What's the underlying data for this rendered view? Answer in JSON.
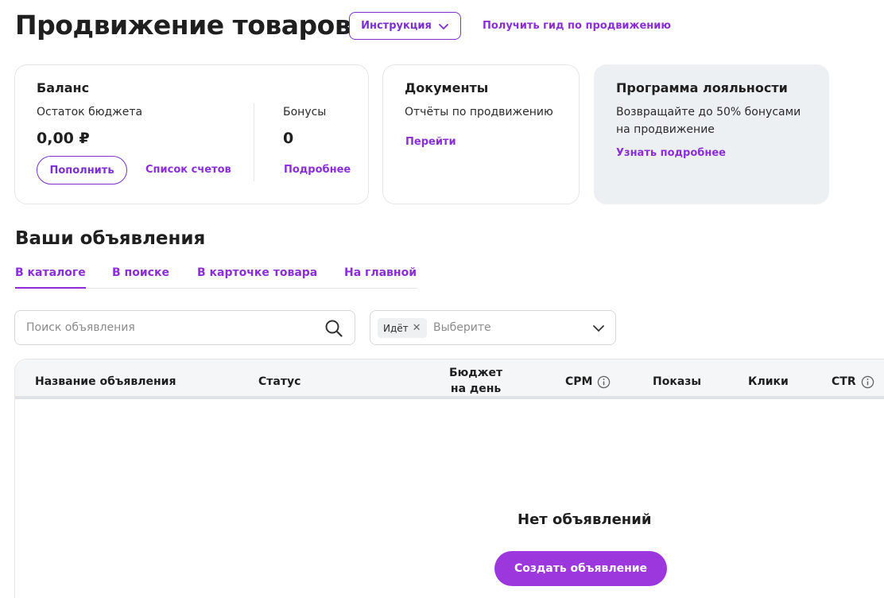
{
  "header": {
    "title": "Продвижение товаров",
    "instruction_label": "Инструкция",
    "guide_link": "Получить гид по продвижению"
  },
  "balance": {
    "title": "Баланс",
    "budget_label": "Остаток бюджета",
    "budget_value": "0,00 ₽",
    "topup_label": "Пополнить",
    "invoices_link": "Список счетов",
    "bonuses_label": "Бонусы",
    "bonuses_value": "0",
    "details_link": "Подробнее"
  },
  "documents": {
    "title": "Документы",
    "text": "Отчёты по продвижению",
    "link": "Перейти"
  },
  "loyalty": {
    "title": "Программа лояльности",
    "text_line1": "Возвращайте до 50% бонусами",
    "text_line2": "на продвижение",
    "link": "Узнать подробнее",
    "bg_color": "#edf0f2"
  },
  "ads": {
    "title": "Ваши объявления",
    "tabs": [
      {
        "label": "В каталоге",
        "active": true
      },
      {
        "label": "В поиске",
        "active": false
      },
      {
        "label": "В карточке товара",
        "active": false
      },
      {
        "label": "На главной",
        "active": false
      }
    ],
    "search_placeholder": "Поиск объявления",
    "status_filter": {
      "chip": "Идёт",
      "placeholder": "Выберите"
    },
    "columns": {
      "name": "Название объявления",
      "status": "Статус",
      "budget_line1": "Бюджет",
      "budget_line2": "на день",
      "cpm": "CPM",
      "views": "Показы",
      "clicks": "Клики",
      "ctr": "CTR"
    },
    "empty_title": "Нет объявлений",
    "create_label": "Создать объявление"
  },
  "colors": {
    "accent": "#8b2ed8",
    "button_primary": "#9c37dd"
  }
}
